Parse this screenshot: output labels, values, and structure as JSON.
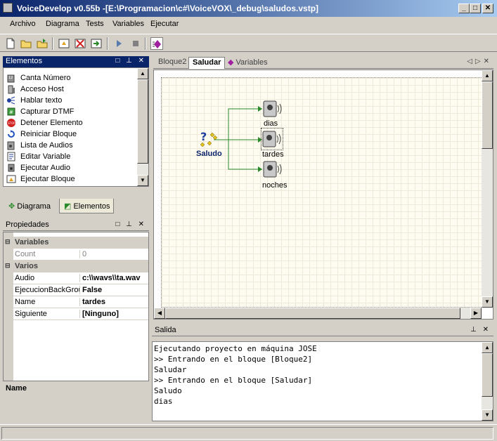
{
  "window": {
    "title": "VoiceDevelop v0.55b  -[E:\\Programacion\\c#\\VoiceVOX\\_debug\\saludos.vstp]",
    "minimize": "_",
    "maximize": "□",
    "close": "✕"
  },
  "menu": [
    "Archivo",
    "Diagrama",
    "Tests",
    "Variables",
    "Ejecutar"
  ],
  "toolbar": {
    "icons": [
      "new-file-icon",
      "open-folder-icon",
      "open-project-icon",
      "block-icon",
      "delete-block-icon",
      "export-icon",
      "run-icon",
      "stop-icon",
      "variables-icon"
    ]
  },
  "elementos": {
    "title": "Elementos",
    "items": [
      {
        "label": "Canta Número",
        "icon": "canta-numero-icon"
      },
      {
        "label": "Acceso Host",
        "icon": "acceso-host-icon"
      },
      {
        "label": "Hablar texto",
        "icon": "hablar-texto-icon"
      },
      {
        "label": "Capturar DTMF",
        "icon": "capturar-dtmf-icon"
      },
      {
        "label": "Detener Elemento",
        "icon": "stop-icon"
      },
      {
        "label": "Reiniciar Bloque",
        "icon": "reiniciar-icon"
      },
      {
        "label": "Lista de Audios",
        "icon": "lista-audios-icon"
      },
      {
        "label": "Editar Variable",
        "icon": "editar-variable-icon"
      },
      {
        "label": "Ejecutar Audio",
        "icon": "ejecutar-audio-icon"
      },
      {
        "label": "Ejecutar Bloque",
        "icon": "ejecutar-bloque-icon"
      }
    ]
  },
  "bottom_tabs": [
    {
      "label": "Diagrama",
      "icon": "diagrama-icon"
    },
    {
      "label": "Elementos",
      "icon": "elementos-icon"
    }
  ],
  "propiedades": {
    "title": "Propiedades",
    "categories": [
      {
        "name": "Variables",
        "rows": [
          {
            "name": "Count",
            "value": "0"
          }
        ]
      },
      {
        "name": "Varios",
        "rows": [
          {
            "name": "Audio",
            "value": "c:\\\\wavs\\\\ta.wav"
          },
          {
            "name": "EjecucionBackGround",
            "value": "False"
          },
          {
            "name": "Name",
            "value": "tardes"
          },
          {
            "name": "Siguiente",
            "value": "[Ninguno]"
          }
        ]
      }
    ],
    "description_title": "Name"
  },
  "doc_tabs": [
    {
      "label": "Bloque2",
      "active": false
    },
    {
      "label": "Saludar",
      "active": true
    },
    {
      "label": "Variables",
      "active": false
    }
  ],
  "diagram": {
    "source_label": "Saludo",
    "targets": [
      "dias",
      "tardes",
      "noches"
    ],
    "selected": "tardes"
  },
  "salida": {
    "title": "Salida",
    "lines": [
      "Ejecutando proyecto en máquina JOSE",
      ">> Entrando en el bloque [Bloque2]",
      "Saludar",
      ">> Entrando en el bloque [Saludar]",
      "Saludo",
      "dias"
    ]
  },
  "status": ""
}
